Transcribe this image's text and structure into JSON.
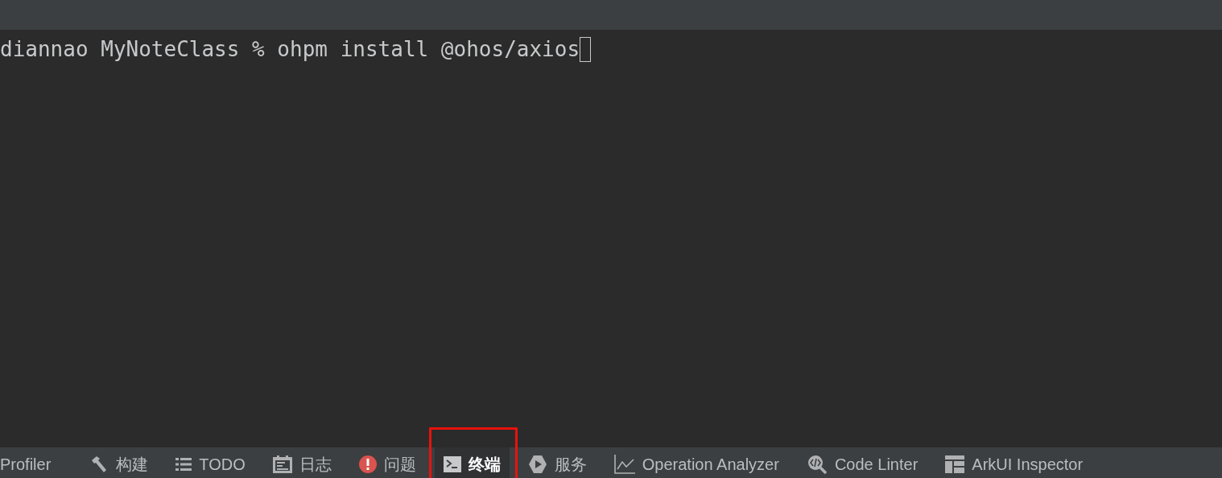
{
  "terminal": {
    "lines": [
      "diannao MyNoteClass % ohpm install @ohos/axios"
    ],
    "cursor": true
  },
  "tool_tabs": [
    {
      "label": "Profiler",
      "selected": false,
      "highlighted": false
    },
    {
      "label": "构建",
      "selected": false,
      "highlighted": false
    },
    {
      "label": "TODO",
      "selected": false,
      "highlighted": false
    },
    {
      "label": "日志",
      "selected": false,
      "highlighted": false
    },
    {
      "label": "问题",
      "selected": false,
      "highlighted": false
    },
    {
      "label": "终端",
      "selected": true,
      "highlighted": true
    },
    {
      "label": "服务",
      "selected": false,
      "highlighted": false
    },
    {
      "label": "Operation Analyzer",
      "selected": false,
      "highlighted": false
    },
    {
      "label": "Code Linter",
      "selected": false,
      "highlighted": false
    },
    {
      "label": "ArkUI Inspector",
      "selected": false,
      "highlighted": false
    }
  ]
}
